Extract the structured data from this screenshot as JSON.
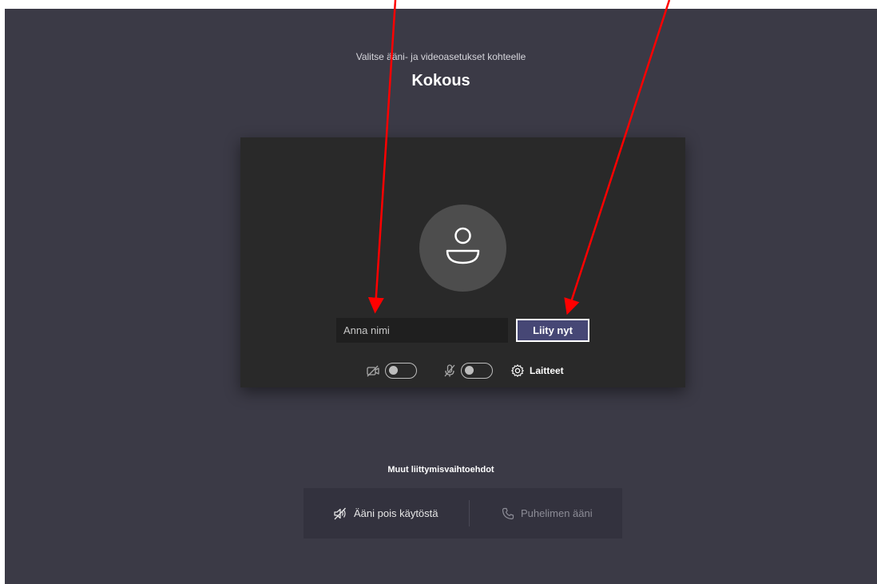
{
  "header": {
    "prompt": "Valitse ääni- ja videoasetukset kohteelle",
    "meeting_title": "Kokous"
  },
  "preview": {
    "avatar_icon": "person-icon",
    "name_input": {
      "placeholder": "Anna nimi",
      "value": ""
    },
    "join_button_label": "Liity nyt",
    "controls": {
      "camera_icon": "camera-off-icon",
      "camera_on": false,
      "mic_icon": "mic-off-icon",
      "mic_on": false,
      "devices_icon": "gear-icon",
      "devices_label": "Laitteet"
    }
  },
  "other_options": {
    "title": "Muut liittymisvaihtoehdot",
    "audio_off_icon": "speaker-off-icon",
    "audio_off_label": "Ääni pois käytöstä",
    "phone_icon": "phone-icon",
    "phone_label": "Puhelimen ääni"
  },
  "colors": {
    "background": "#3b3a46",
    "card": "#292929",
    "accent": "#464775",
    "annotation_arrow": "#ff0000"
  }
}
